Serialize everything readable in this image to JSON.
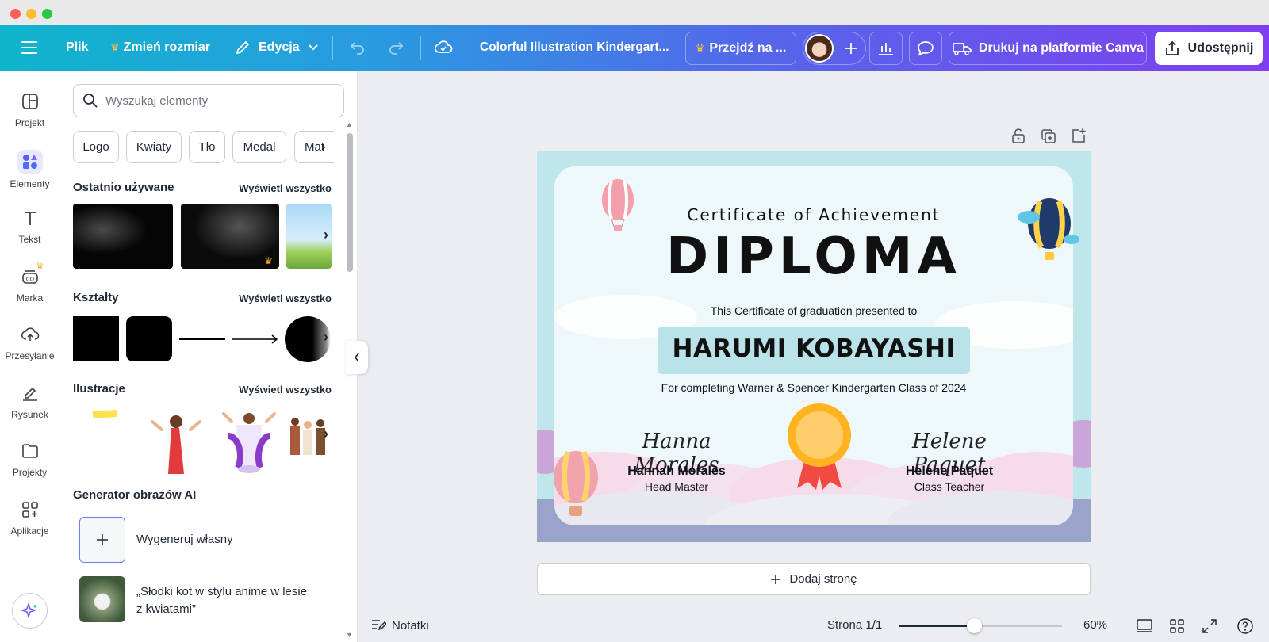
{
  "topbar": {
    "file": "Plik",
    "resize": "Zmień rozmiar",
    "edit": "Edycja",
    "doc_title": "Colorful Illustration Kindergart...",
    "upgrade": "Przejdź na ...",
    "print": "Drukuj na platformie Canva",
    "share": "Udostępnij"
  },
  "rail": [
    {
      "label": "Projekt"
    },
    {
      "label": "Elementy"
    },
    {
      "label": "Tekst"
    },
    {
      "label": "Marka"
    },
    {
      "label": "Przesyłanie"
    },
    {
      "label": "Rysunek"
    },
    {
      "label": "Projekty"
    },
    {
      "label": "Aplikacje"
    }
  ],
  "panel": {
    "search_placeholder": "Wyszukaj elementy",
    "chips": [
      "Logo",
      "Kwiaty",
      "Tło",
      "Medal",
      "Mat"
    ],
    "recent": {
      "title": "Ostatnio używane",
      "link": "Wyświetl wszystko"
    },
    "shapes": {
      "title": "Kształty",
      "link": "Wyświetl wszystko"
    },
    "illustrations": {
      "title": "Ilustracje",
      "link": "Wyświetl wszystko"
    },
    "ai": {
      "title": "Generator obrazów AI",
      "generate": "Wygeneruj własny",
      "sample_line1": "„Słodki kot w stylu anime w lesie",
      "sample_line2": "z kwiatami”"
    }
  },
  "certificate": {
    "subtitle": "Certificate of Achievement",
    "title": "DIPLOMA",
    "presented": "This Certificate of graduation presented to",
    "name": "HARUMI KOBAYASHI",
    "completing": "For completing Warner & Spencer Kindergarten Class of 2024",
    "signer1": {
      "signature": "Hanna Morales",
      "name": "Hannah Morales",
      "role": "Head Master"
    },
    "signer2": {
      "signature": "Helene Paquet",
      "name": "Helene Paquet",
      "role": "Class Teacher"
    }
  },
  "add_page": "Dodaj stronę",
  "bottombar": {
    "notes": "Notatki",
    "page": "Strona 1/1",
    "zoom": "60%",
    "zoom_fraction": 0.46
  },
  "colors": {
    "accent": "#7d2ae8",
    "topbar_start": "#0fb5cc",
    "topbar_end": "#7f3ff0",
    "name_box": "#b9e3e8",
    "cert_bg": "#bfe6ea"
  }
}
